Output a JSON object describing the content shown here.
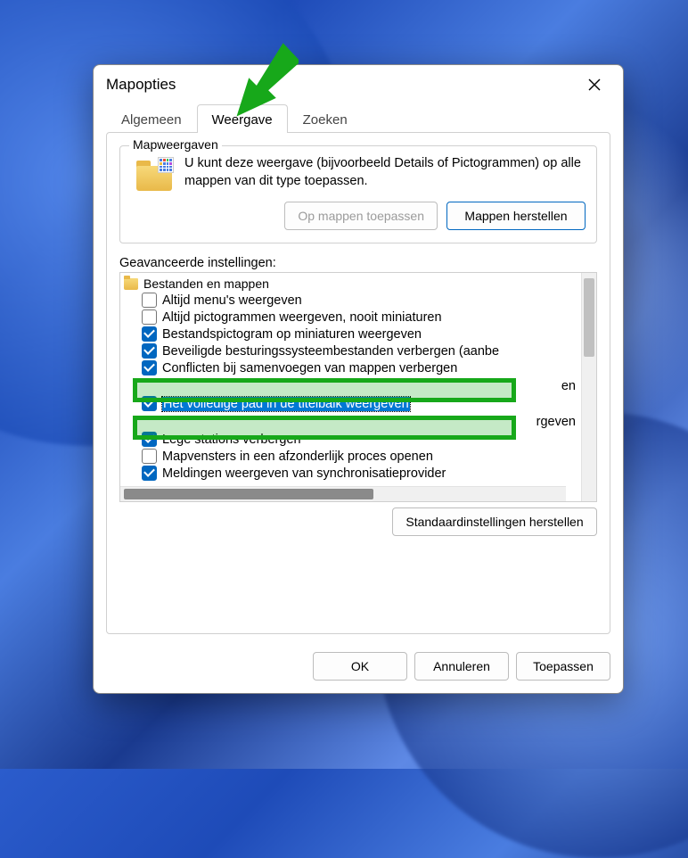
{
  "dialog": {
    "title": "Mapopties",
    "tabs": [
      {
        "label": "Algemeen",
        "active": false
      },
      {
        "label": "Weergave",
        "active": true
      },
      {
        "label": "Zoeken",
        "active": false
      }
    ]
  },
  "folder_views": {
    "group_label": "Mapweergaven",
    "description": "U kunt deze weergave (bijvoorbeeld Details of Pictogrammen) op alle mappen van dit type toepassen.",
    "apply_btn": "Op mappen toepassen",
    "reset_btn": "Mappen herstellen"
  },
  "advanced": {
    "label": "Geavanceerde instellingen:",
    "root": "Bestanden en mappen",
    "items": [
      {
        "label": "Altijd menu's weergeven",
        "checked": false
      },
      {
        "label": "Altijd pictogrammen weergeven, nooit miniaturen",
        "checked": false
      },
      {
        "label": "Bestandspictogram op miniaturen weergeven",
        "checked": true
      },
      {
        "label": "Beveiligde besturingssysteembestanden verbergen (aanbe",
        "checked": true
      },
      {
        "label": "Conflicten bij samenvoegen van mappen verbergen",
        "checked": true
      },
      {
        "label_partial_right": "en",
        "checked": true,
        "obscured": true
      },
      {
        "label": "Het volledige pad in de titelbalk weergeven",
        "checked": true,
        "highlighted": true,
        "selected": true
      },
      {
        "label_partial_right": "rgeven",
        "checked": true,
        "obscured": true
      },
      {
        "label": "Lege stations verbergen",
        "checked": true
      },
      {
        "label": "Mapvensters in een afzonderlijk proces openen",
        "checked": false
      },
      {
        "label": "Meldingen weergeven van synchronisatieprovider",
        "checked": true
      }
    ],
    "restore_defaults": "Standaardinstellingen herstellen"
  },
  "actions": {
    "ok": "OK",
    "cancel": "Annuleren",
    "apply": "Toepassen"
  }
}
